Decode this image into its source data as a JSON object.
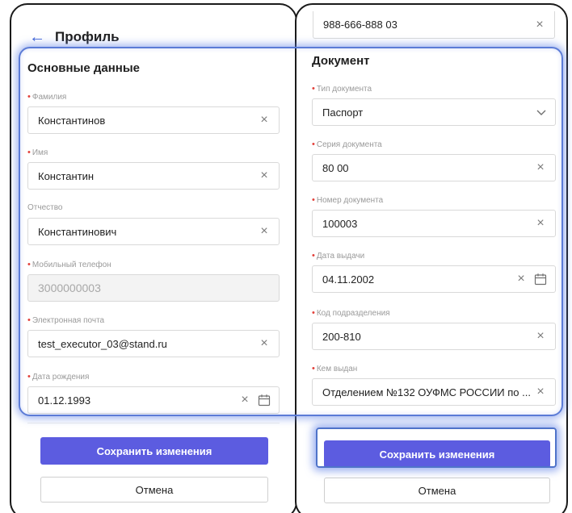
{
  "left": {
    "header": {
      "back_icon": "←",
      "title": "Профиль"
    },
    "section_title": "Основные данные",
    "fields": {
      "last_name": {
        "label": "Фамилия",
        "value": "Константинов",
        "required": true
      },
      "first_name": {
        "label": "Имя",
        "value": "Константин",
        "required": true
      },
      "patronymic": {
        "label": "Отчество",
        "value": "Константинович",
        "required": false
      },
      "phone": {
        "label": "Мобильный телефон",
        "value": "3000000003",
        "required": true
      },
      "email": {
        "label": "Электронная почта",
        "value": "test_executor_03@stand.ru",
        "required": true
      },
      "birth_date": {
        "label": "Дата рождения",
        "value": "01.12.1993",
        "required": true
      }
    },
    "save_label": "Сохранить изменения",
    "cancel_label": "Отмена"
  },
  "right": {
    "top_field": {
      "value": "988-666-888 03"
    },
    "section_title": "Документ",
    "fields": {
      "doc_type": {
        "label": "Тип документа",
        "value": "Паспорт",
        "required": true
      },
      "doc_series": {
        "label": "Серия документа",
        "value": "80 00",
        "required": true
      },
      "doc_number": {
        "label": "Номер документа",
        "value": "100003",
        "required": true
      },
      "issue_date": {
        "label": "Дата выдачи",
        "value": "04.11.2002",
        "required": true
      },
      "dept_code": {
        "label": "Код подразделения",
        "value": "200-810",
        "required": true
      },
      "issued_by": {
        "label": "Кем выдан",
        "value": "Отделением №132 ОУФМС РОССИИ по ...",
        "required": true
      }
    },
    "save_label": "Сохранить изменения",
    "cancel_label": "Отмена"
  },
  "icons": {
    "clear": "×",
    "required_mark": "•"
  },
  "colors": {
    "primary": "#5c5ce0",
    "required": "#e2413b",
    "highlight": "#5b7bd6",
    "back_arrow": "#3a5fd6"
  }
}
